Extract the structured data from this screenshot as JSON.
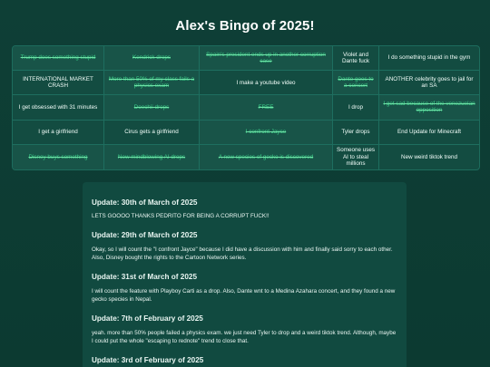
{
  "page": {
    "title": "Alex's Bingo of 2025!"
  },
  "bingo": {
    "cells": [
      {
        "label": "Trump does something stupid",
        "marked": true
      },
      {
        "label": "Kendrick drops",
        "marked": true
      },
      {
        "label": "Spain's president ends up in another corruption case",
        "marked": true
      },
      {
        "label": "Violet and Dante fuck",
        "marked": false
      },
      {
        "label": "I do something stupid in the gym",
        "marked": false
      },
      {
        "label": "INTERNATIONAL MARKET CRASH",
        "marked": false
      },
      {
        "label": "More than 50% of my class fails a physics exam",
        "marked": true
      },
      {
        "label": "I make a youtube video",
        "marked": false
      },
      {
        "label": "Dante goes to a concert",
        "marked": true
      },
      {
        "label": "ANOTHER celebrity goes to jail for an SA",
        "marked": false
      },
      {
        "label": "I get obsessed with 31 minutes",
        "marked": false
      },
      {
        "label": "Doechii drops",
        "marked": true
      },
      {
        "label": "FREE",
        "marked": true
      },
      {
        "label": "I drop",
        "marked": false
      },
      {
        "label": "I get sad because of the venezuelan opposition",
        "marked": true
      },
      {
        "label": "I get a girlfriend",
        "marked": false
      },
      {
        "label": "Cirus gets a girlfriend",
        "marked": false
      },
      {
        "label": "I confront Jayce",
        "marked": true
      },
      {
        "label": "Tyler drops",
        "marked": false
      },
      {
        "label": "End Update for Minecraft",
        "marked": false
      },
      {
        "label": "Disney buys something",
        "marked": true
      },
      {
        "label": "New mindblowing AI drops",
        "marked": true
      },
      {
        "label": "A new species of gecko is discovered",
        "marked": true
      },
      {
        "label": "Someone uses AI to steal millions",
        "marked": false
      },
      {
        "label": "New weird tiktok trend",
        "marked": false
      }
    ]
  },
  "updates": [
    {
      "title": "Update: 30th of March of 2025",
      "body": "LETS GOOOO THANKS PEDRITO FOR BEING A CORRUPT FUCK!!"
    },
    {
      "title": "Update: 29th of March of 2025",
      "body": "Okay, so I will count the \"I confront Jayce\" because I did have a discussion with him and finally said sorry to each other. Also, Disney bought the rights to the Cartoon Network series."
    },
    {
      "title": "Update: 31st of March of 2025",
      "body": "I will count the feature with Playboy Carti as a drop. Also, Dante wnt to a Medina Azahara concert, and they found a new gecko species in Nepal."
    },
    {
      "title": "Update: 7th of February of 2025",
      "body": "yeah. more than 50% people failed a physics exam. we just need Tyler to drop and a weird tiktok trend. Although, maybe I could put the whole \"escaping to rednote\" trend to close that."
    },
    {
      "title": "Update: 3rd of February of 2025",
      "body": ""
    }
  ]
}
